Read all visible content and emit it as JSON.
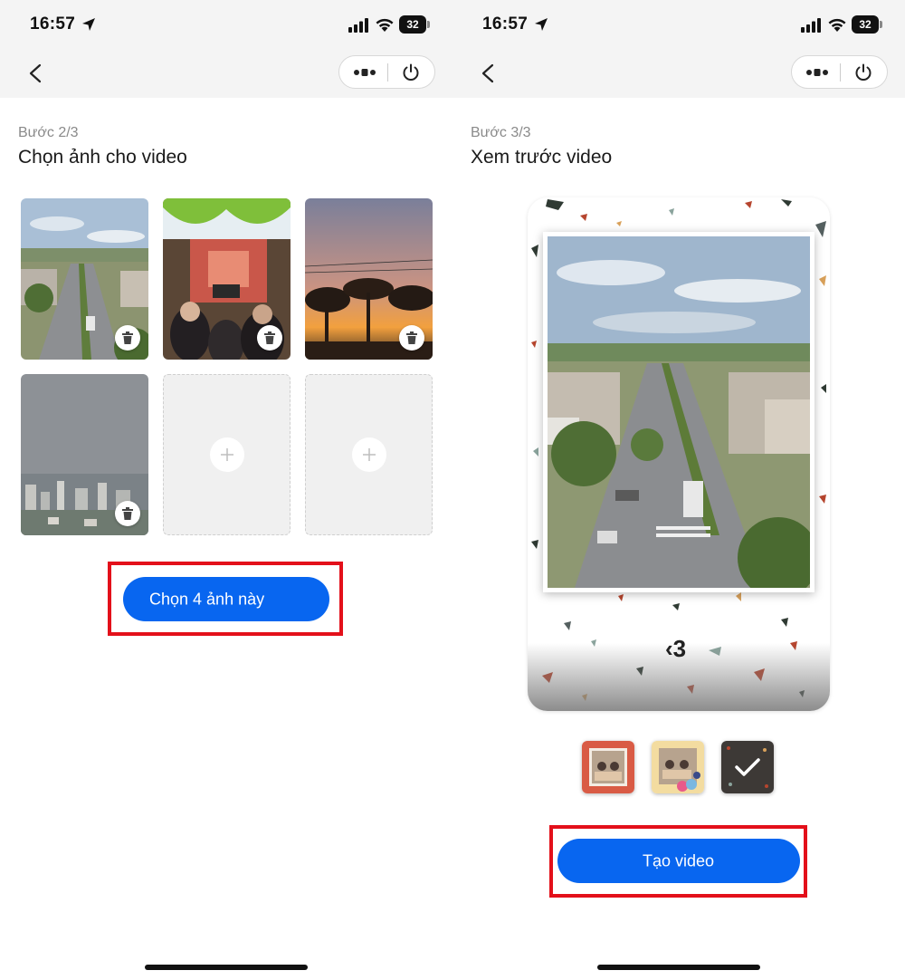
{
  "status_bar": {
    "time": "16:57",
    "battery": "32"
  },
  "screen_left": {
    "step": "Bước 2/3",
    "title": "Chọn ảnh cho video",
    "photos": [
      {
        "name": "street-photo"
      },
      {
        "name": "party-photo"
      },
      {
        "name": "sunset-photo"
      },
      {
        "name": "city-photo"
      }
    ],
    "confirm_button": "Chọn 4 ảnh này"
  },
  "screen_right": {
    "step": "Bước 3/3",
    "title": "Xem trước video",
    "counter": "‹3",
    "templates": [
      {
        "name": "template-red-frame",
        "selected": false
      },
      {
        "name": "template-yellow-frame",
        "selected": false
      },
      {
        "name": "template-terrazzo",
        "selected": true
      }
    ],
    "create_button": "Tạo video"
  },
  "colors": {
    "accent": "#0866f0",
    "highlight_frame": "#e3101a"
  }
}
